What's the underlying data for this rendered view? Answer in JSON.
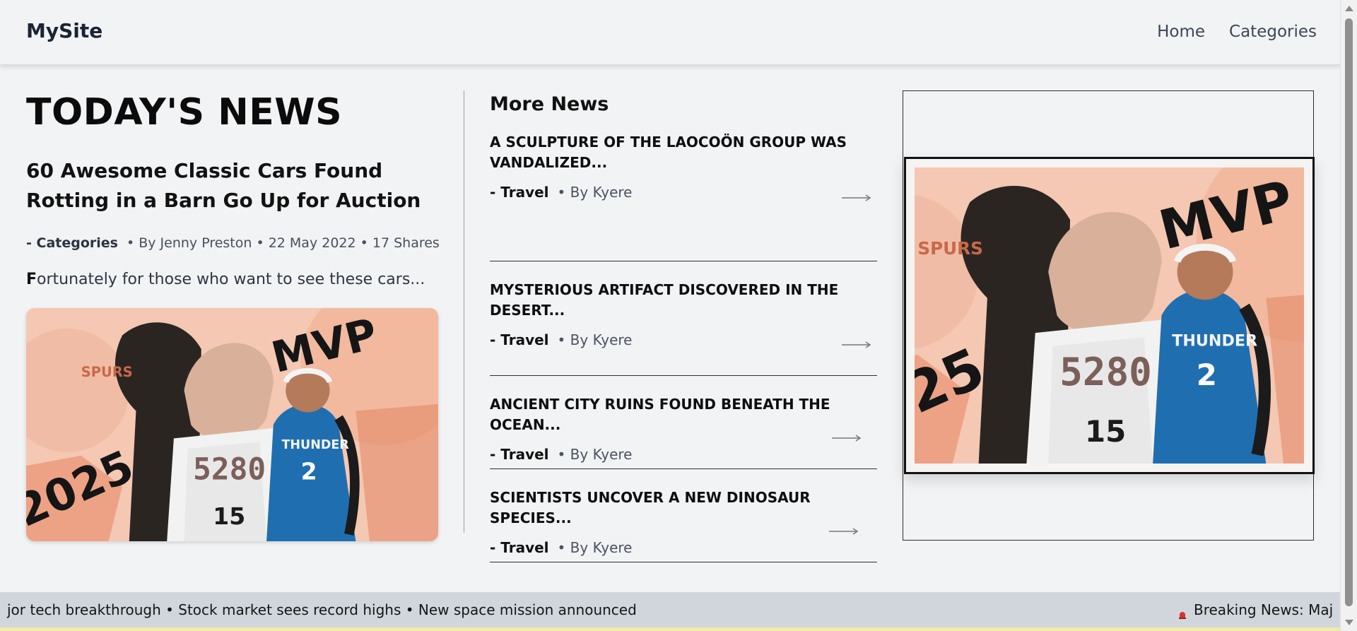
{
  "nav": {
    "brand": "MySite",
    "links": [
      "Home",
      "Categories"
    ]
  },
  "left": {
    "heading": "TODAY'S NEWS",
    "feature_title": "60 Awesome Classic Cars Found Rotting in a Barn Go Up for Auction",
    "meta": {
      "category": "- Categories",
      "details": "• By Jenny Preston • 22 May 2022 • 17 Shares"
    },
    "excerpt_first": "F",
    "excerpt_rest": "ortunately for those who want to see these cars..."
  },
  "image_text": {
    "year": "2025",
    "mvp": "MVP",
    "team_a": "SPURS",
    "jersey_a": "5280",
    "number_a": "15",
    "team_b": "THUNDER",
    "number_b": "2"
  },
  "middle": {
    "heading": "More News",
    "items": [
      {
        "title": "A SCULPTURE OF THE LAOCOÖN GROUP WAS VANDALIZED...",
        "category": "- Travel",
        "author": "• By Kyere"
      },
      {
        "title": "MYSTERIOUS ARTIFACT DISCOVERED IN THE DESERT...",
        "category": "- Travel",
        "author": "• By Kyere"
      },
      {
        "title": "ANCIENT CITY RUINS FOUND BENEATH THE OCEAN...",
        "category": "- Travel",
        "author": "• By Kyere"
      },
      {
        "title": "SCIENTISTS UNCOVER A NEW DINOSAUR SPECIES...",
        "category": "- Travel",
        "author": "• By Kyere"
      }
    ]
  },
  "ticker": {
    "left_text": "jor tech breakthrough • Stock market sees record highs • New space mission announced",
    "right_text": "Breaking News: Maj"
  },
  "icons": {
    "arrow": "right-arrow-icon",
    "siren": "siren-icon"
  },
  "colors": {
    "background": "#f2f3f5",
    "ticker": "#d1d6dd",
    "brand": "#1b2433",
    "accent_orange": "#e8845f",
    "thunder_blue": "#1f6fb0"
  }
}
